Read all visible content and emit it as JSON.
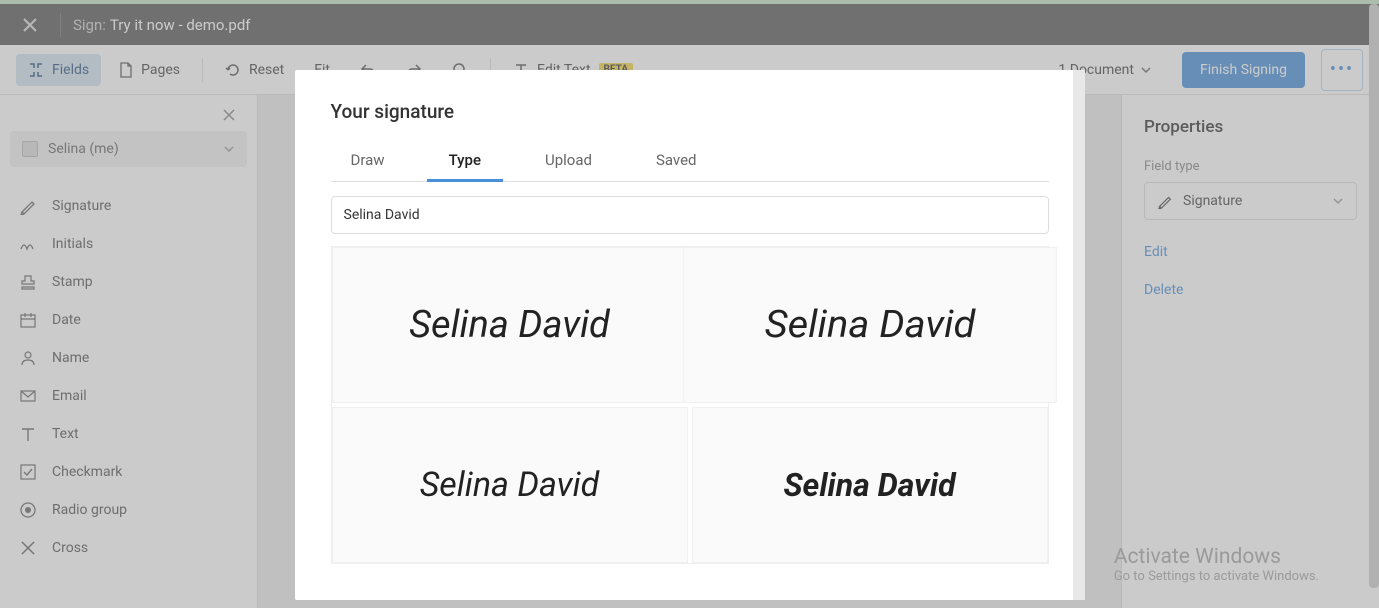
{
  "header": {
    "title_label": "Sign:",
    "title_file": "Try it now - demo.pdf"
  },
  "toolbar": {
    "fields": "Fields",
    "pages": "Pages",
    "reset": "Reset",
    "fit": "Fit",
    "edit_text": "Edit Text",
    "beta": "BETA",
    "document_count": "1 Document",
    "finish": "Finish Signing"
  },
  "sidebar": {
    "signer": "Selina (me)",
    "items": [
      {
        "label": "Signature"
      },
      {
        "label": "Initials"
      },
      {
        "label": "Stamp"
      },
      {
        "label": "Date"
      },
      {
        "label": "Name"
      },
      {
        "label": "Email"
      },
      {
        "label": "Text"
      },
      {
        "label": "Checkmark"
      },
      {
        "label": "Radio group"
      },
      {
        "label": "Cross"
      }
    ]
  },
  "properties": {
    "title": "Properties",
    "field_type_label": "Field type",
    "field_type_value": "Signature",
    "edit": "Edit",
    "delete": "Delete"
  },
  "modal": {
    "title": "Your signature",
    "tabs": {
      "draw": "Draw",
      "type": "Type",
      "upload": "Upload",
      "saved": "Saved"
    },
    "name_value": "Selina David",
    "signatures": [
      "Selina David",
      "Selina David",
      "Selina David",
      "Selina David"
    ]
  },
  "watermark": {
    "line1": "Activate Windows",
    "line2": "Go to Settings to activate Windows."
  }
}
